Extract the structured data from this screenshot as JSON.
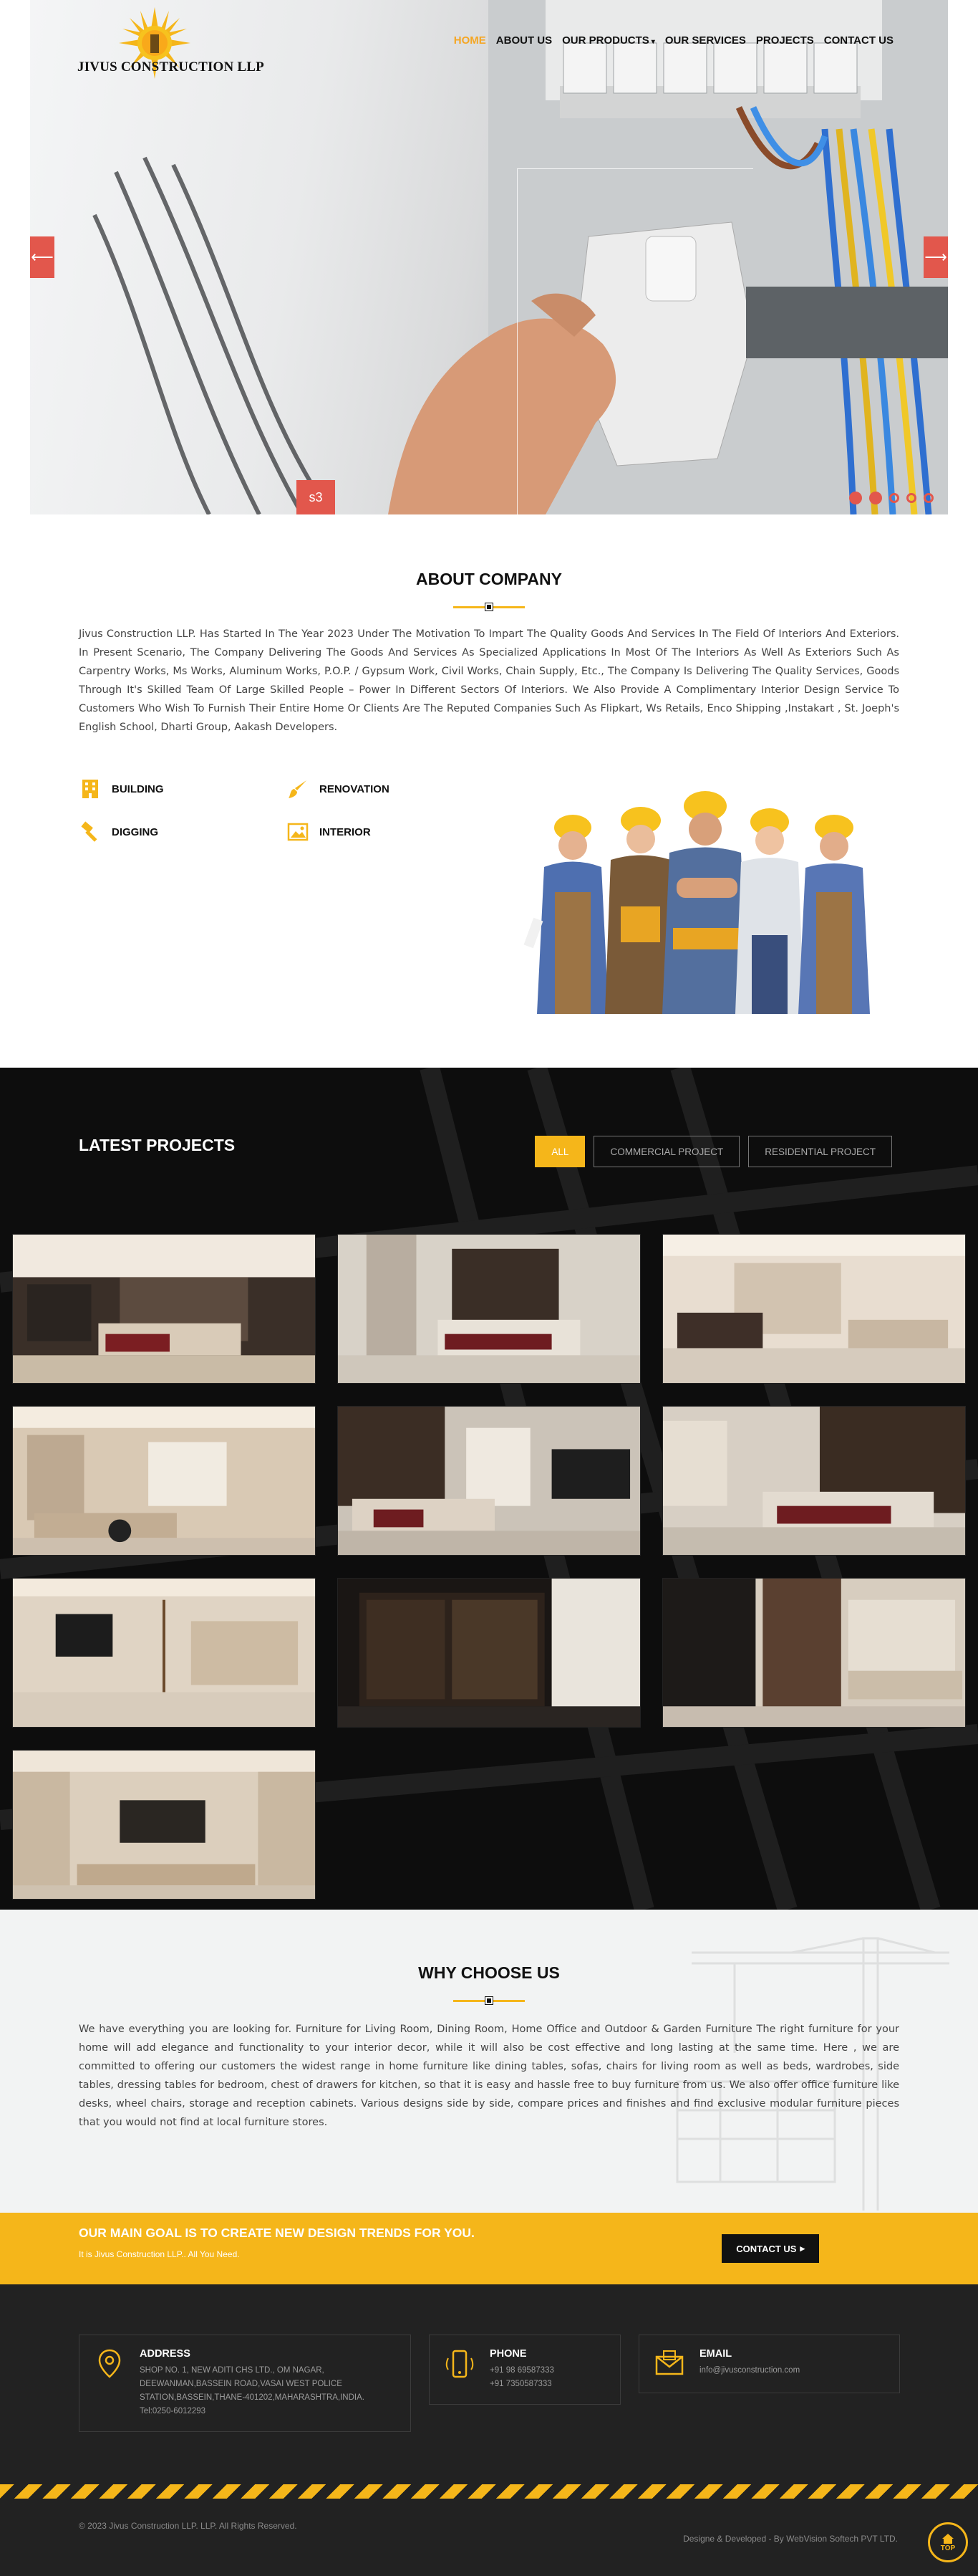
{
  "header": {
    "brand": "JIVUS CONSTRUCTION LLP",
    "nav": [
      {
        "label": "HOME"
      },
      {
        "label": "ABOUT US"
      },
      {
        "label": "OUR PRODUCTS"
      },
      {
        "label": "OUR SERVICES"
      },
      {
        "label": "PROJECTS"
      },
      {
        "label": "CONTACT US"
      }
    ]
  },
  "hero": {
    "slide_label": "s3",
    "prev_icon": "arrow-left-icon",
    "next_icon": "arrow-right-icon"
  },
  "about": {
    "title": "ABOUT COMPANY",
    "text": "Jivus Construction LLP. Has Started In The Year 2023 Under The Motivation To Impart The Quality Goods And Services In The Field Of Interiors And Exteriors. In Present Scenario, The Company Delivering The Goods And Services As Specialized Applications In Most Of The Interiors As Well As Exteriors Such As Carpentry Works, Ms Works, Aluminum Works, P.O.P. / Gypsum Work, Civil Works, Chain Supply, Etc., The Company Is Delivering The Quality Services, Goods Through It's Skilled Team Of Large Skilled People – Power In Different Sectors Of Interiors. We Also Provide A Complimentary Interior Design Service To Customers Who Wish To Furnish Their Entire Home Or Clients Are The Reputed Companies Such As Flipkart, Ws Retails, Enco Shipping ,Instakart , St. Joeph's English School, Dharti Group, Aakash Developers.",
    "features": [
      {
        "label": "BUILDING"
      },
      {
        "label": "RENOVATION"
      },
      {
        "label": "DIGGING"
      },
      {
        "label": "INTERIOR"
      }
    ]
  },
  "projects": {
    "title": "LATEST PROJECTS",
    "filters": [
      {
        "label": "ALL"
      },
      {
        "label": "COMMERCIAL PROJECT"
      },
      {
        "label": "RESIDENTIAL PROJECT"
      }
    ]
  },
  "why": {
    "title": "WHY CHOOSE US",
    "text": "We have everything you are looking for. Furniture for Living Room, Dining Room, Home Office and Outdoor & Garden Furniture The right furniture for your home will add elegance and functionality to your interior decor, while it will also be cost effective and long lasting at the same time. Here , we are committed to offering our customers the widest range in home furniture like dining tables, sofas, chairs for living room as well as beds, wardrobes, side tables, dressing tables for bedroom, chest of drawers for kitchen, so that it is easy and hassle free to buy furniture from us. We also offer office furniture like desks, wheel chairs, storage and reception cabinets. Various designs side by side, compare prices and finishes and find exclusive modular furniture pieces that you would not find at local furniture stores."
  },
  "goal": {
    "title": "OUR MAIN GOAL IS TO CREATE NEW DESIGN TRENDS FOR YOU.",
    "subtitle": "It is Jivus Construction LLP.. All You Need.",
    "cta": "CONTACT US"
  },
  "footer": {
    "address": {
      "title": "ADDRESS",
      "lines": [
        "SHOP NO. 1, NEW ADITI CHS LTD., OM NAGAR,",
        "DEEWANMAN,BASSEIN ROAD,VASAI WEST POLICE",
        "STATION,BASSEIN,THANE-401202,MAHARASHTRA,INDIA.",
        "Tel:0250-6012293"
      ]
    },
    "phone": {
      "title": "PHONE",
      "lines": [
        "+91 98 69587333",
        "+91 7350587333"
      ]
    },
    "email": {
      "title": "EMAIL",
      "lines": [
        "info@jivusconstruction.com"
      ]
    },
    "copyright": "© 2023 Jivus Construction LLP. LLP. All Rights Reserved.",
    "developer": "Designe & Developed - By WebVision Softech PVT LTD.",
    "top_label": "TOP"
  },
  "colors": {
    "accent": "#f5b61a",
    "nav_active": "#f5a623",
    "slider_red": "#e2574c",
    "dark": "#0d0d0d"
  }
}
